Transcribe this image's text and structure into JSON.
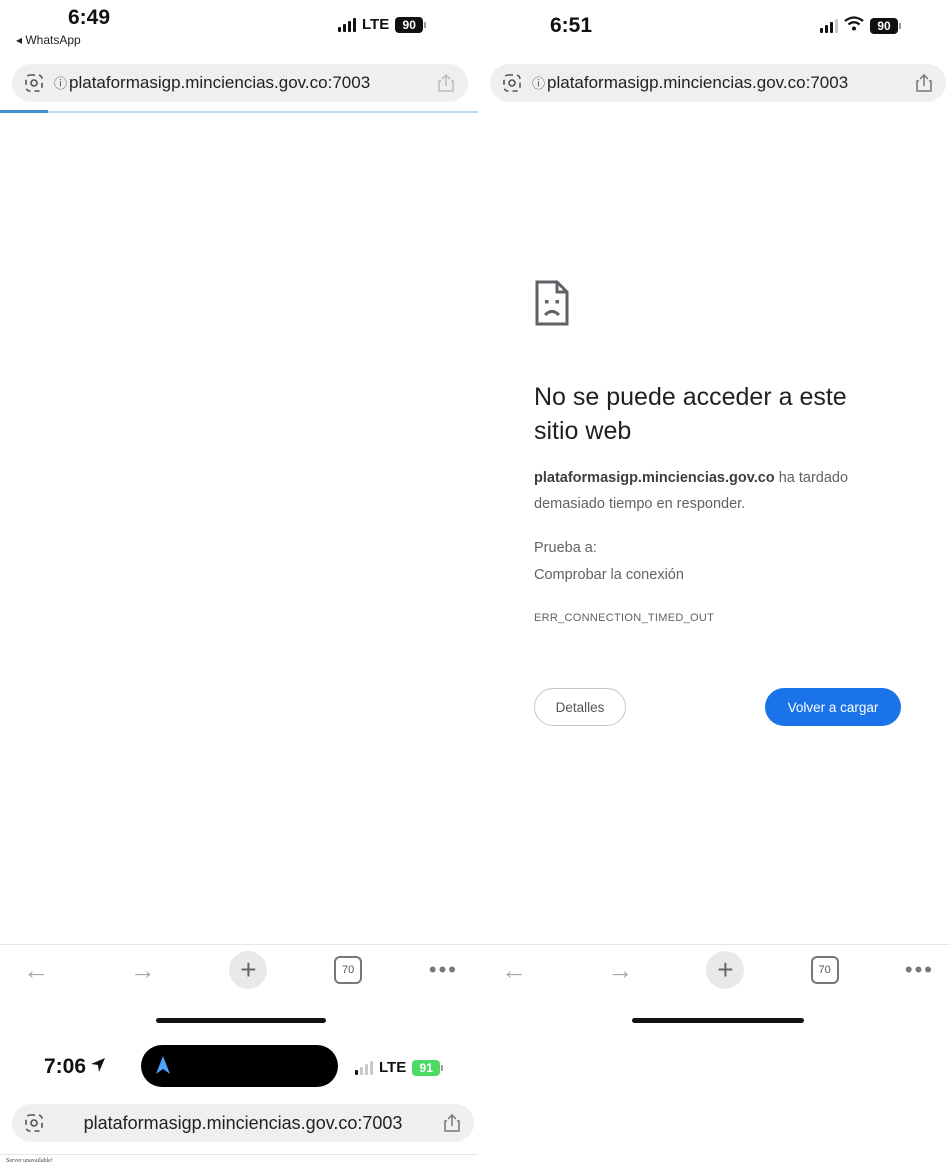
{
  "panel_left": {
    "time": "6:49",
    "back_app": "◂ WhatsApp",
    "network": "LTE",
    "battery": "90",
    "url": "plataformasigp.minciencias.gov.co:7003",
    "tabs_count": "70"
  },
  "panel_right": {
    "time": "6:51",
    "battery": "90",
    "url": "plataformasigp.minciencias.gov.co:7003",
    "error": {
      "title": "No se puede acceder a este sitio web",
      "host": "plataformasigp.minciencias.gov.co",
      "message_rest": " ha tardado demasiado tiempo en responder.",
      "try_label": "Prueba a:",
      "suggestion": "Comprobar la conexión",
      "code": "ERR_CONNECTION_TIMED_OUT",
      "details_button": "Detalles",
      "reload_button": "Volver a cargar"
    },
    "tabs_count": "70"
  },
  "panel_bottom": {
    "time": "7:06",
    "network": "LTE",
    "battery": "91",
    "url": "plataformasigp.minciencias.gov.co:7003",
    "page_text": "Server unavailable!"
  },
  "colors": {
    "accent": "#1a73e8",
    "loading_bar": "#4a8fd6",
    "battery_charging": "#4cd964"
  },
  "icons": {
    "lens": "page-lens-icon",
    "share": "share-icon",
    "sad_page": "sad-page-icon",
    "location": "location-arrow-icon"
  }
}
